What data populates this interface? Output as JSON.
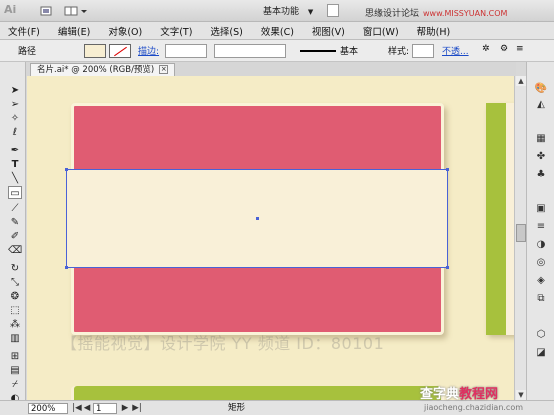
{
  "app": {
    "logo": "Ai",
    "workspace": "基本功能",
    "workspace_arrow": "▼"
  },
  "watermark_top": {
    "text": "思缘设计论坛",
    "sub": "www.MISSYUAN.COM"
  },
  "menu": [
    "文件(F)",
    "编辑(E)",
    "对象(O)",
    "文字(T)",
    "选择(S)",
    "效果(C)",
    "视图(V)",
    "窗口(W)",
    "帮助(H)"
  ],
  "control": {
    "label": "路径",
    "stroke_label": "描边:",
    "brush_label": "基本",
    "style_label": "样式:",
    "opacity_label": "不透...",
    "more_label": "≡"
  },
  "document": {
    "tab_title": "名片.ai* @ 200% (RGB/预览)",
    "close_glyph": "×"
  },
  "canvas": {
    "watermark": "【摇能视觉】设计学院  YY 频道 ID：80101"
  },
  "status": {
    "zoom": "200%",
    "page": "1",
    "tool": "矩形",
    "prev": "◀",
    "next": "▶",
    "first": "|◀",
    "last": "▶|"
  },
  "site_watermark": {
    "part1": "查字典",
    "part2": "教程网",
    "sub": "jiaocheng.chazidian.com"
  },
  "colors": {
    "red": "#e05c72",
    "cream": "#f9f0d8",
    "green": "#a7c13d",
    "selection": "#4a62d6"
  },
  "tools_left": [
    "selection-arrow",
    "direct-select",
    "magic-wand",
    "lasso",
    "pen",
    "type",
    "line",
    "rectangle",
    "paintbrush",
    "pencil",
    "blob-brush",
    "eraser",
    "rotate",
    "scale",
    "warp",
    "free-transform",
    "symbol-sprayer",
    "graph",
    "mesh",
    "gradient",
    "eyedropper",
    "blend",
    "live-paint",
    "artboard",
    "hand",
    "zoom"
  ],
  "tools_right": [
    "color-guide",
    "gradient",
    "swatches",
    "brushes",
    "symbols",
    "graphic-styles",
    "stroke",
    "transparency",
    "appearance",
    "layers",
    "align"
  ]
}
